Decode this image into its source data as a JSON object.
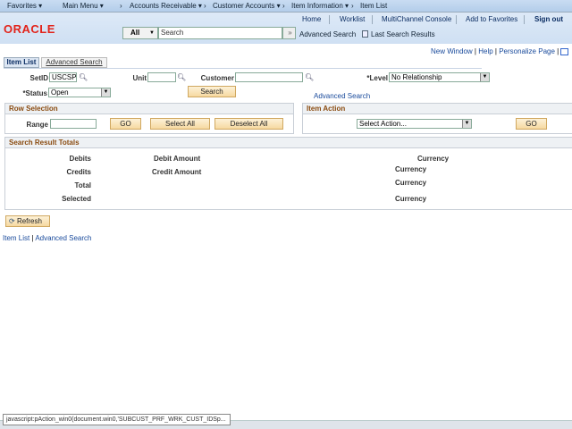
{
  "nav": {
    "favorites": "Favorites ▾",
    "main_menu": "Main Menu ▾",
    "crumbs": [
      "Accounts Receivable ▾",
      "Customer Accounts ▾",
      "Item Information ▾",
      "Item List"
    ]
  },
  "header": {
    "logo": "ORACLE",
    "links": [
      "Home",
      "Worklist",
      "MultiChannel Console",
      "Add to Favorites"
    ],
    "sign_out": "Sign out",
    "search_scope": "All",
    "search_placeholder": "Search",
    "advanced_search": "Advanced Search",
    "last_results": "Last Search Results"
  },
  "pagelinks": {
    "new_window": "New Window",
    "help": "Help",
    "personalize": "Personalize Page"
  },
  "tabs": [
    "Item List",
    "Advanced Search"
  ],
  "form": {
    "setid_label": "SetID",
    "setid": "USCSP",
    "unit_label": "Unit",
    "unit": "",
    "customer_label": "Customer",
    "customer": "",
    "level_label": "*Level",
    "level": "No Relationship",
    "status_label": "*Status",
    "status": "Open",
    "search_btn": "Search",
    "advanced_link": "Advanced Search"
  },
  "row_selection": {
    "title": "Row Selection",
    "range_label": "Range",
    "range": "",
    "go": "GO",
    "select_all": "Select All",
    "deselect_all": "Deselect All"
  },
  "item_action": {
    "title": "Item Action",
    "select": "Select Action...",
    "go": "GO"
  },
  "totals": {
    "title": "Search Result Totals",
    "debits": "Debits",
    "debit_amount": "Debit Amount",
    "credits": "Credits",
    "credit_amount": "Credit Amount",
    "total": "Total",
    "selected": "Selected",
    "currency": "Currency"
  },
  "refresh": "Refresh",
  "footer": {
    "item_list": "Item List",
    "sep": "|",
    "advanced": "Advanced Search"
  },
  "status_bar": "javascript:pAction_win0(document.win0,'SUBCUST_PRF_WRK_CUST_IDSp..."
}
